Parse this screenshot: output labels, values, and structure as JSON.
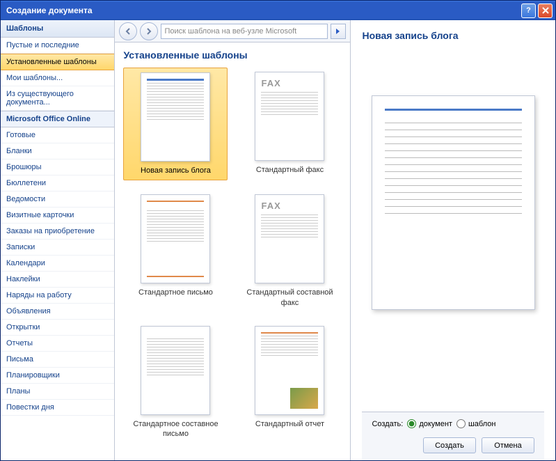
{
  "titlebar": {
    "text": "Создание документа"
  },
  "sidebar": {
    "header": "Шаблоны",
    "items": [
      {
        "label": "Пустые и последние"
      },
      {
        "label": "Установленные шаблоны",
        "selected": true
      },
      {
        "label": "Мои шаблоны..."
      },
      {
        "label": "Из существующего документа..."
      }
    ],
    "section": "Microsoft Office Online",
    "online_items": [
      {
        "label": "Готовые"
      },
      {
        "label": "Бланки"
      },
      {
        "label": "Брошюры"
      },
      {
        "label": "Бюллетени"
      },
      {
        "label": "Ведомости"
      },
      {
        "label": "Визитные карточки"
      },
      {
        "label": "Заказы на приобретение"
      },
      {
        "label": "Записки"
      },
      {
        "label": "Календари"
      },
      {
        "label": "Наклейки"
      },
      {
        "label": "Наряды на работу"
      },
      {
        "label": "Объявления"
      },
      {
        "label": "Открытки"
      },
      {
        "label": "Отчеты"
      },
      {
        "label": "Письма"
      },
      {
        "label": "Планировщики"
      },
      {
        "label": "Планы"
      },
      {
        "label": "Повестки дня"
      }
    ]
  },
  "toolbar": {
    "search_placeholder": "Поиск шаблона на веб-узле Microsoft"
  },
  "content": {
    "header": "Установленные шаблоны",
    "templates": [
      {
        "label": "Новая запись блога",
        "selected": true,
        "kind": "blog"
      },
      {
        "label": "Стандартный факс",
        "kind": "fax"
      },
      {
        "label": "Стандартное письмо",
        "kind": "letter"
      },
      {
        "label": "Стандартный составной факс",
        "kind": "fax2"
      },
      {
        "label": "Стандартное составное письмо",
        "kind": "letter2"
      },
      {
        "label": "Стандартный отчет",
        "kind": "report"
      }
    ]
  },
  "preview": {
    "title": "Новая запись блога"
  },
  "footer": {
    "create_label": "Создать:",
    "radio_doc": "документ",
    "radio_template": "шаблон",
    "btn_create": "Создать",
    "btn_cancel": "Отмена"
  }
}
